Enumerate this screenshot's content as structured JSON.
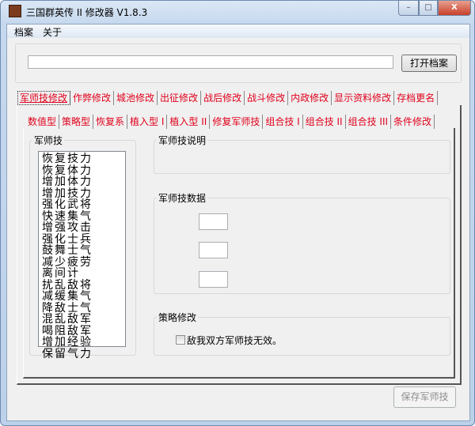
{
  "window": {
    "title": "三国群英传 II 修改器 V1.8.3",
    "minimize": "–",
    "maximize": "□",
    "close": "X"
  },
  "menu": [
    "档案",
    "关于"
  ],
  "file": {
    "path_value": "",
    "open_button": "打开档案"
  },
  "main_tabs": [
    "军师技修改",
    "作弊修改",
    "城池修改",
    "出征修改",
    "战后修改",
    "战斗修改",
    "内政修改",
    "显示资料修改",
    "存档更名"
  ],
  "sub_tabs": [
    "数值型",
    "策略型",
    "恢复系",
    "植入型 I",
    "植入型 II",
    "修复军师技",
    "组合技 I",
    "组合技 II",
    "组合技 III",
    "条件修改"
  ],
  "skills_group": {
    "label": "军师技",
    "items": [
      "恢复技力",
      "恢复体力",
      "增加体力",
      "增加技力",
      "强化武将",
      "快速集气",
      "增强攻击",
      "强化士兵",
      "鼓舞士气",
      "减少疲劳",
      "离间计",
      "扰乱敌将",
      "减缓集气",
      "降敌士气",
      "混乱敌军",
      "喝阻敌军",
      "增加经验",
      "保留气力"
    ]
  },
  "desc_group": {
    "label": "军师技说明"
  },
  "data_group": {
    "label": "军师技数据",
    "values": [
      "",
      "",
      ""
    ]
  },
  "strategy_group": {
    "label": "策略修改",
    "checkbox_label": "敌我双方军师技无效。",
    "checked": false
  },
  "save_button": "保存军师技"
}
